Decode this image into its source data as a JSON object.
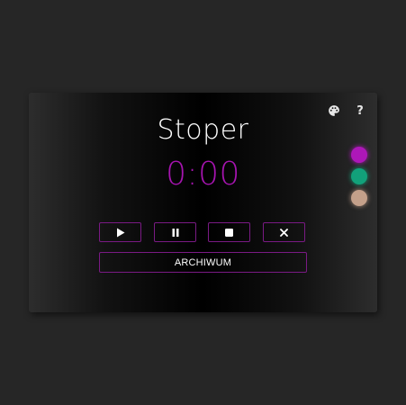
{
  "app": {
    "title": "Stoper",
    "time": "0:00",
    "archive_label": "ARCHIWUM",
    "help_label": "?"
  },
  "controls": [
    {
      "name": "play",
      "icon": "play-icon"
    },
    {
      "name": "pause",
      "icon": "pause-icon"
    },
    {
      "name": "stop",
      "icon": "stop-icon"
    },
    {
      "name": "reset",
      "icon": "close-icon"
    }
  ],
  "toolbar": {
    "palette_icon": "palette-icon"
  },
  "theme_colors": [
    {
      "name": "purple",
      "color": "#ad17b8"
    },
    {
      "name": "green",
      "color": "#12a17a"
    },
    {
      "name": "beige",
      "color": "#c4a08a"
    }
  ],
  "accent_color": "#a614b0",
  "border_color": "#7a1a84"
}
